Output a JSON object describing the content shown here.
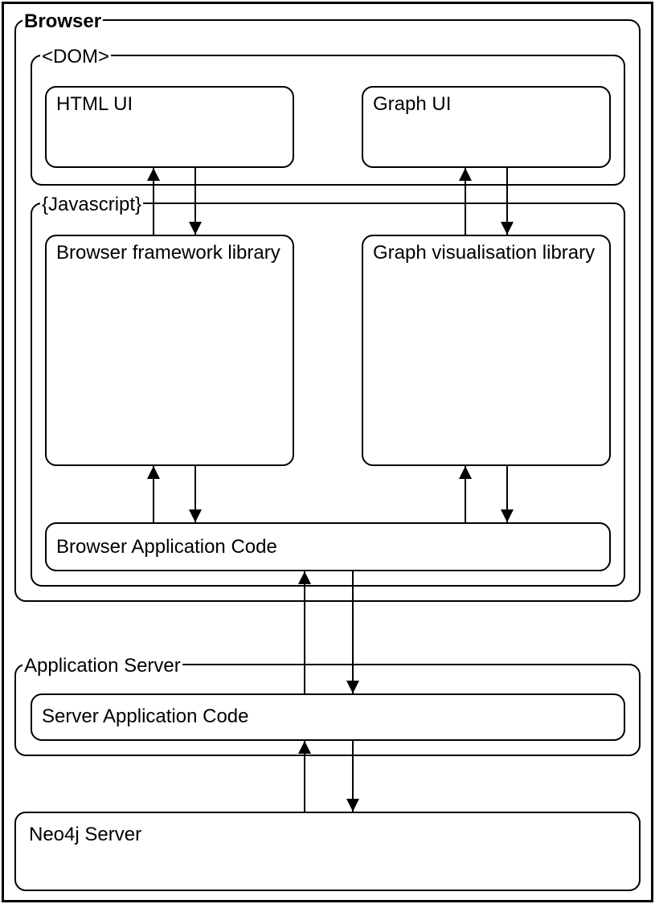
{
  "diagram": {
    "browser": {
      "title": "Browser",
      "dom": {
        "title": "<DOM>",
        "html_ui": "HTML UI",
        "graph_ui": "Graph UI"
      },
      "javascript": {
        "title": "{Javascript}",
        "framework_library": "Browser framework library",
        "graphviz_library": "Graph visualisation library",
        "app_code": "Browser Application Code"
      }
    },
    "app_server": {
      "title": "Application Server",
      "server_code": "Server Application Code"
    },
    "neo4j": "Neo4j Server"
  }
}
